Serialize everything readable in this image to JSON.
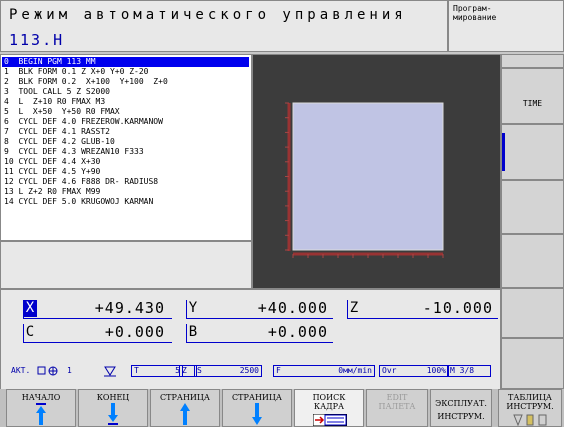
{
  "header": {
    "mode_title": "Режим автоматического управления",
    "file_name": "113.H",
    "secondary_mode": [
      "Програм-",
      "мирование"
    ]
  },
  "program": {
    "lines": [
      "0  BEGIN PGM 113 MM",
      "1  BLK FORM 0.1 Z X+0 Y+0 Z-20",
      "2  BLK FORM 0.2  X+100  Y+100  Z+0",
      "3  TOOL CALL 5 Z S2000",
      "4  L  Z+10 R0 FMAX M3",
      "5  L  X+50  Y+50 R0 FMAX",
      "6  CYCL DEF 4.0 FREZEROW.KARMANOW",
      "7  CYCL DEF 4.1 RASST2",
      "8  CYCL DEF 4.2 GLUB-10",
      "9  CYCL DEF 4.3 WREZAN10 F333",
      "10 CYCL DEF 4.4 X+30",
      "11 CYCL DEF 4.5 Y+90",
      "12 CYCL DEF 4.6 F888 DR- RADIUS8",
      "13 L Z+2 R0 FMAX M99",
      "14 CYCL DEF 5.0 KRUGOWOJ KARMAN"
    ],
    "selected_index": 0
  },
  "coords": {
    "x_label": "X",
    "x_value": "+49.430",
    "y_label": "Y",
    "y_value": "+40.000",
    "z_label": "Z",
    "z_value": "-10.000",
    "c_label": "C",
    "c_value": "+0.000",
    "b_label": "B",
    "b_value": "+0.000"
  },
  "status": {
    "akt": "АКТ.",
    "tool_no": "1",
    "t_label": "T",
    "t_value": "5",
    "axis": "Z",
    "s_label": "S",
    "s_value": "2500",
    "f_label": "F",
    "f_value": "0мм/min",
    "ovr_label": "Ovr",
    "ovr_value": "100%",
    "m_value": "M 3/8"
  },
  "side_softkeys": {
    "time": "TIME"
  },
  "bottom_softkeys": [
    {
      "label": "НАЧАЛО"
    },
    {
      "label": "КОНЕЦ"
    },
    {
      "label": "СТРАНИЦА"
    },
    {
      "label": "СТРАНИЦА"
    },
    {
      "label_1": "ПОИСК",
      "label_2": "КАДРА"
    },
    {
      "label_1": "EDIT",
      "label_2": "ПАЛЕТА"
    },
    {
      "label_1": "ЭКСПЛУАТ.",
      "label_2": "ИНСТРУМ."
    },
    {
      "label_1": "ТАБЛИЦА",
      "label_2": "ИНСТРУМ."
    }
  ]
}
